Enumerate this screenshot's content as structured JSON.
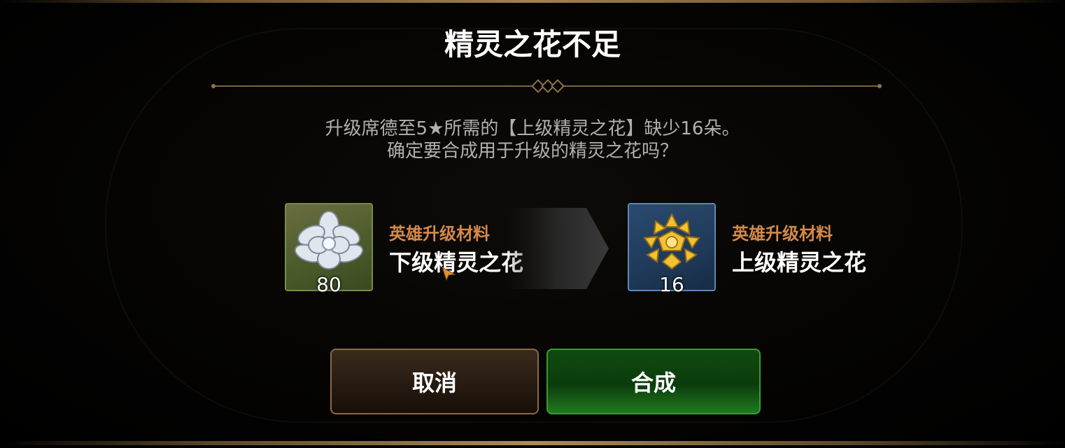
{
  "dialog": {
    "title": "精灵之花不足",
    "message_line1": "升级席德至5★所需的【上级精灵之花】缺少16朵。",
    "message_line2": "确定要合成用于升级的精灵之花吗？"
  },
  "source_item": {
    "category": "英雄升级材料",
    "name": "下级精灵之花",
    "count": "80",
    "icon": "silver-flower-icon"
  },
  "target_item": {
    "category": "英雄升级材料",
    "name": "上级精灵之花",
    "count": "16",
    "icon": "gold-flower-icon"
  },
  "buttons": {
    "cancel_label": "取消",
    "confirm_label": "合成"
  },
  "colors": {
    "category_text": "#d48a4a",
    "confirm_button": "#1f7a1e",
    "cancel_button": "#3a2a1c",
    "divider": "#7a6440"
  }
}
